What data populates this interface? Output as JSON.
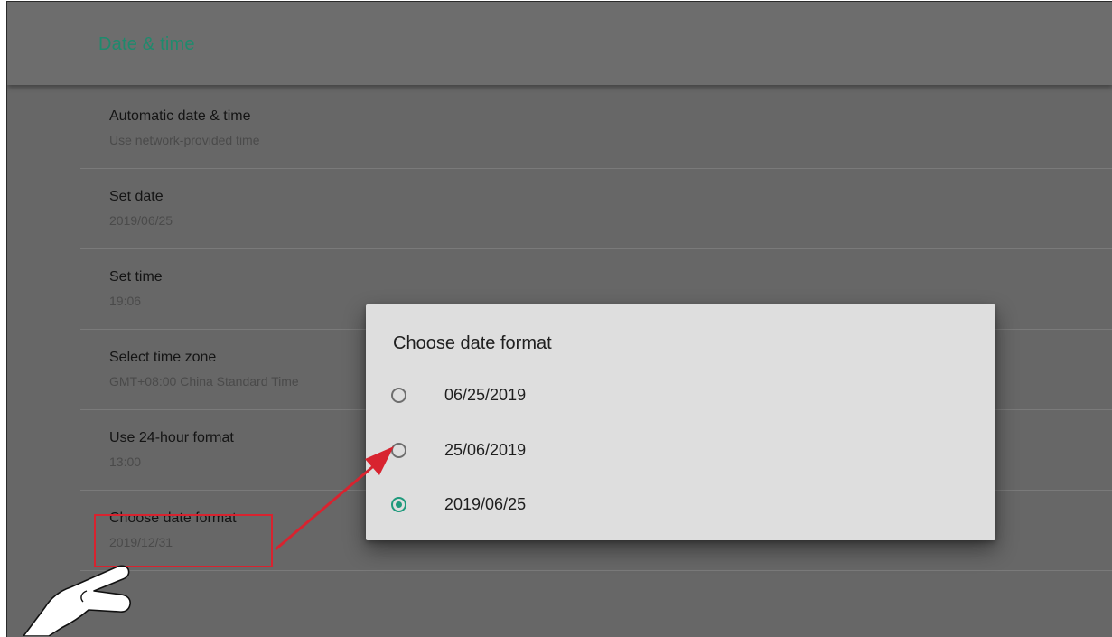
{
  "header": {
    "title": "Date & time"
  },
  "settings": [
    {
      "title": "Automatic date & time",
      "summary": "Use network-provided time"
    },
    {
      "title": "Set date",
      "summary": "2019/06/25"
    },
    {
      "title": "Set time",
      "summary": "19:06"
    },
    {
      "title": "Select time zone",
      "summary": "GMT+08:00 China Standard Time"
    },
    {
      "title": "Use 24-hour format",
      "summary": "13:00"
    },
    {
      "title": "Choose date format",
      "summary": "2019/12/31"
    }
  ],
  "dialog": {
    "title": "Choose date format",
    "options": [
      {
        "label": "06/25/2019",
        "selected": false
      },
      {
        "label": "25/06/2019",
        "selected": false
      },
      {
        "label": "2019/06/25",
        "selected": true
      }
    ]
  },
  "colors": {
    "accent": "#1f9a7c",
    "header_title": "#1f8a6d",
    "annotation": "#d8232f",
    "screen_background": "#676767",
    "dialog_background": "#dedede"
  },
  "annotations": {
    "highlight": "red-outline-box",
    "arrow": "red-arrow-icon",
    "pointer": "pointing-hand-icon"
  }
}
